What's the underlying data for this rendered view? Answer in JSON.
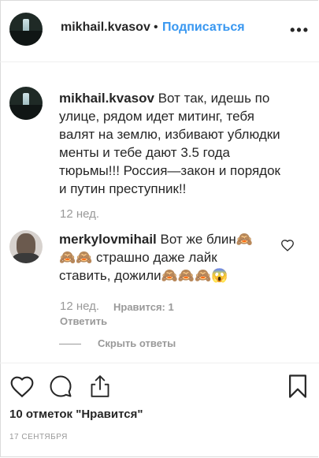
{
  "header": {
    "username": "mikhail.kvasov",
    "dot": "•",
    "follow_label": "Подписаться",
    "more": "•••"
  },
  "caption": {
    "username": "mikhail.kvasov",
    "line1": "Вот так, идешь по",
    "line2": "улице, рядом идет митинг, тебя",
    "line3": "валят на землю, избивают ублюдки",
    "line4": "менты и тебе дают 3.5 года",
    "line5": "тюрьмы!!! Россия—закон и порядок",
    "line6": "и путин преступник!!",
    "time": "12 нед."
  },
  "comment": {
    "username": "merkylovmihail",
    "line1": "Вот же блин🙈",
    "line2": "🙈🙈 страшно даже лайк",
    "line3": "ставить, дожили🙈🙈🙈😱",
    "time": "12 нед.",
    "likes": "Нравится: 1",
    "reply": "Ответить",
    "hide_replies": "Скрыть ответы"
  },
  "footer": {
    "likes": "10 отметок \"Нравится\"",
    "date": "17 СЕНТЯБРЯ"
  },
  "icons": {
    "like": "heart-icon",
    "comment": "comment-icon",
    "share": "share-icon",
    "save": "bookmark-icon",
    "comment_like": "heart-icon"
  }
}
